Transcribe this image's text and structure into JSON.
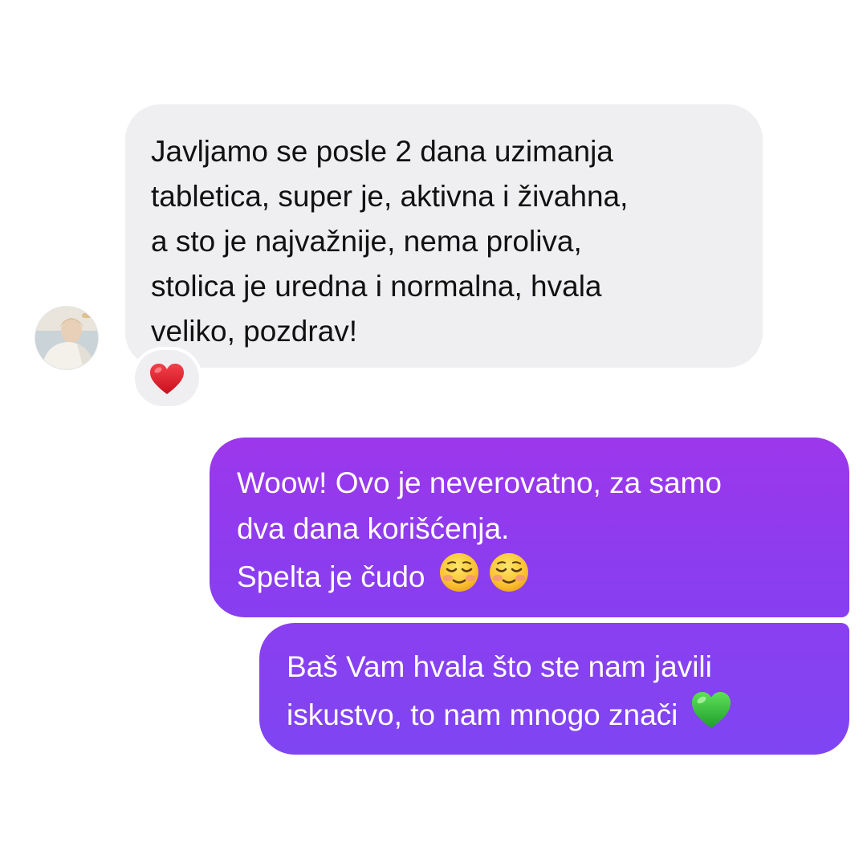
{
  "conversation": {
    "incoming": {
      "lines": [
        "Javljamo se posle 2 dana uzimanja",
        "tabletica, super je, aktivna i živahna,",
        "a sto je najvažnije, nema proliva,",
        "stolica je uredna i normalna, hvala",
        "veliko, pozdrav!"
      ],
      "reaction": "❤️",
      "avatar_icon": "user-avatar-photo"
    },
    "outgoing": [
      {
        "lines": [
          "Woow! Ovo je neverovatno, za samo",
          "dva dana korišćenja.",
          "Spelta je čudo"
        ],
        "emojis": [
          "☺️",
          "☺️"
        ]
      },
      {
        "lines": [
          "Baš Vam hvala što ste nam javili",
          "iskustvo, to nam mnogo znači"
        ],
        "emojis": [
          "💚"
        ]
      }
    ]
  },
  "colors": {
    "incoming_bubble": "#efeff1",
    "outgoing_bubble_top": "#9d37ec",
    "outgoing_bubble_bottom": "#7f45f2",
    "incoming_text": "#111111",
    "outgoing_text": "#ffffff",
    "reaction_heart": "#e0202a",
    "green_heart": "#3cc03c"
  }
}
